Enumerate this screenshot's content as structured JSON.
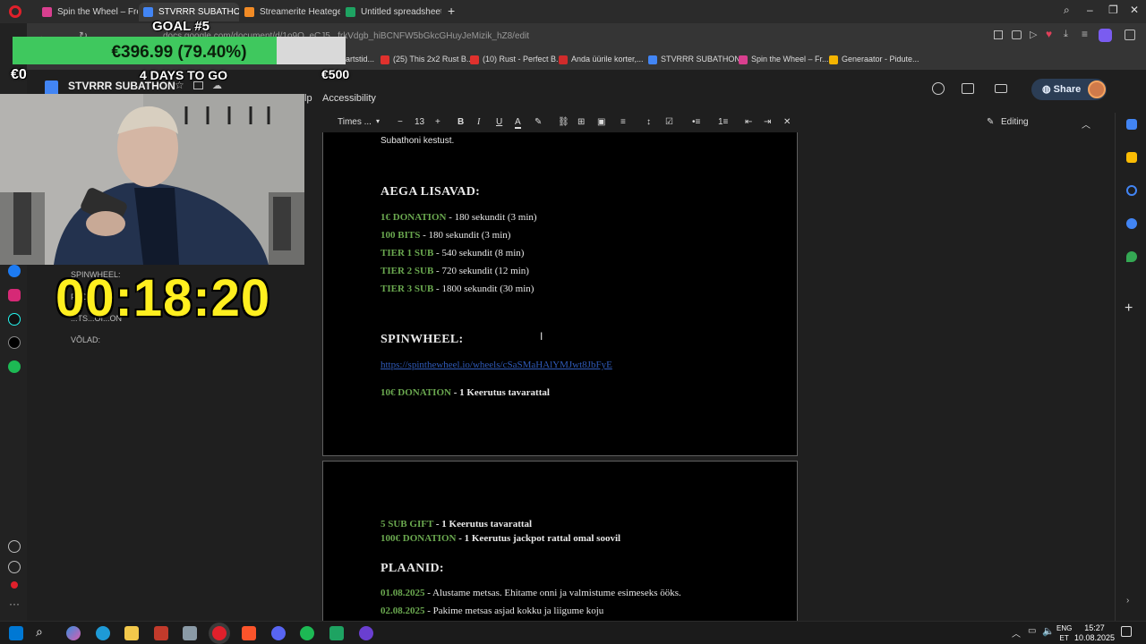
{
  "browser": {
    "tabs": [
      {
        "label": "Spin the Wheel – Free an",
        "color": "#d93f8f",
        "active": false
      },
      {
        "label": "STVRRR SUBATHON - Go",
        "color": "#4285f4",
        "active": true
      },
      {
        "label": "Streamerite Heategevusm",
        "color": "#f28b25",
        "active": false
      },
      {
        "label": "Untitled spreadsheet - Go",
        "color": "#1ea362",
        "active": false
      }
    ],
    "url": "docs.google.com/document/d/1o9Q_eCJ5...frkVdgb_hiBCNFW5bGkcGHuyJeMizik_hZ8/edit",
    "bookmarks": [
      {
        "label": "artstid...",
        "color": "#888888"
      },
      {
        "label": "(25) This 2x2 Rust B...",
        "color": "#e0312d"
      },
      {
        "label": "(10) Rust - Perfect B...",
        "color": "#e0312d"
      },
      {
        "label": "Anda üürile korter,...",
        "color": "#d02b2b"
      },
      {
        "label": "STVRRR SUBATHON...",
        "color": "#4285f4"
      },
      {
        "label": "Spin the Wheel – Fr...",
        "color": "#d93f8f"
      },
      {
        "label": "Generaator - Pidute...",
        "color": "#f4b400"
      }
    ]
  },
  "docs": {
    "title": "STVRRR SUBATHON",
    "menu_partial": "lp",
    "menu_accessibility": "Accessibility",
    "share_label": "Share",
    "toolbar": {
      "font": "Times ...",
      "font_size": "13",
      "mode": "Editing"
    }
  },
  "document": {
    "page1": {
      "intro_tail": "Subathoni kestust.",
      "heading_time": "AEGA LISAVAD:",
      "time_rules": [
        {
          "key": "1€ DONATION",
          "rest": " - 180 sekundit (3 min)"
        },
        {
          "key": "100 BITS",
          "rest": " - 180 sekundit (3 min)"
        },
        {
          "key": "TIER 1 SUB",
          "rest": " - 540 sekundit (8 min)"
        },
        {
          "key": "TIER 2 SUB",
          "rest": " - 720 sekundit (12 min)"
        },
        {
          "key": "TIER 3 SUB",
          "rest": " - 1800 sekundit (30 min)"
        }
      ],
      "heading_spin": "SPINWHEEL:",
      "spin_link": "https://spinthewheel.io/wheels/cSaSMaHAlYMJwt8JbFyE",
      "spin_rule": {
        "key": "10€ DONATION",
        "dash": " - ",
        "rest": "1 Keerutus tavarattal"
      }
    },
    "page2": {
      "rules": [
        {
          "key": "5 SUB GIFT",
          "dash": " - ",
          "rest": "1 Keerutus tavarattal"
        },
        {
          "key": "100€ DONATION",
          "dash": " - ",
          "rest": "1 Keerutus jackpot rattal omal soovil"
        }
      ],
      "heading_plans": "PLAANID:",
      "plans": [
        {
          "date": "01.08.2025",
          "rest": " - Alustame metsas. Ehitame onni ja valmistume esimeseks ööks."
        },
        {
          "date": "02.08.2025",
          "rest": " - Pakime metsas asjad kokku ja liigume koju"
        }
      ]
    }
  },
  "outline": {
    "items": [
      "SPINWHEEL:",
      "P...D",
      "...TS...OI...ON",
      "VÕLAD:"
    ]
  },
  "overlay": {
    "goal_title": "GOAL #5",
    "goal_amount": "€396.99 (79.40%)",
    "goal_progress": 0.794,
    "goal_start": "€0",
    "goal_end": "€500",
    "days_to_go": "4 DAYS TO GO",
    "timer": "00:18:20"
  },
  "system": {
    "lang1": "ENG",
    "lang2": "ET",
    "time": "15:27",
    "date": "10.08.2025"
  }
}
